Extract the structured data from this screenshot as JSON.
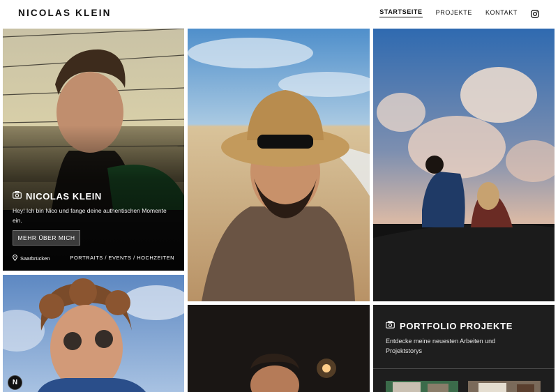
{
  "header": {
    "brand": "NICOLAS KLEIN",
    "nav": [
      "STARTSEITE",
      "PROJEKTE",
      "KONTAKT"
    ],
    "active_nav": "STARTSEITE",
    "social_icon": "instagram-icon"
  },
  "profile_card": {
    "icon": "camera-icon",
    "title": "NICOLAS KLEIN",
    "description": "Hey! Ich bin Nico und fange deine authentischen Momente ein.",
    "button_label": "MEHR ÜBER MICH",
    "location_icon": "map-pin-icon",
    "location": "Saarbrücken",
    "categories": "PORTRAITS / EVENTS / HOCHZEITEN"
  },
  "portfolio_card": {
    "icon": "camera-icon",
    "title": "PORTFOLIO PROJEKTE",
    "description": "Entdecke meine neuesten Arbeiten und Projektstorys"
  },
  "badge": {
    "label": "N"
  },
  "colors": {
    "text": "#111111",
    "panel": "#1e1e1e",
    "button": "#3b3b3b"
  }
}
